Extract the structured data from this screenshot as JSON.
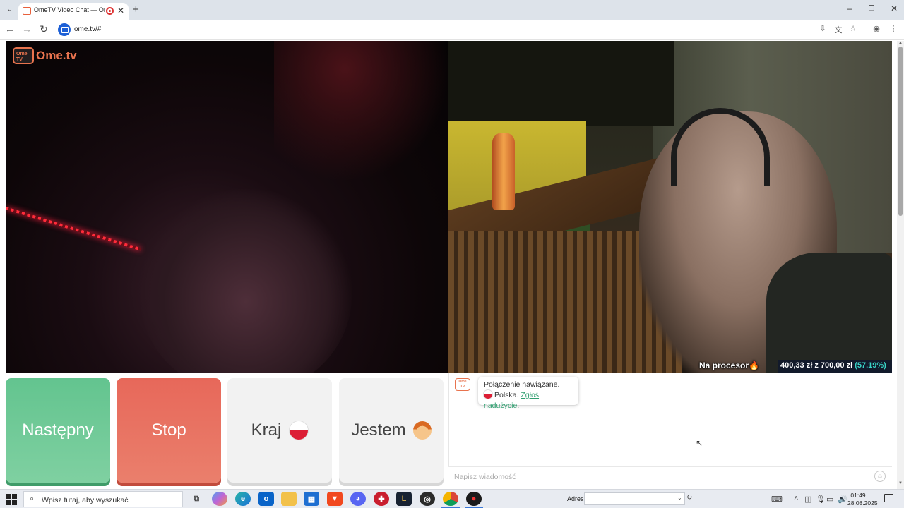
{
  "browser": {
    "tab_title": "OmeTV Video Chat — Ome",
    "url": "ome.tv/#",
    "new_tab_symbol": "+",
    "close_symbol": "✕"
  },
  "video": {
    "logo_box_text": "Ome TV",
    "logo_text": "Ome.tv",
    "overlay_caption": "Na procesor🔥",
    "donation_amount": "400,33 zł z 700,00 zł",
    "donation_percent": "(57.19%)",
    "donation_progress": 0.5719
  },
  "buttons": {
    "next": "Następny",
    "stop": "Stop",
    "country": "Kraj",
    "gender": "Jestem"
  },
  "chat": {
    "connected_message": "Połączenie nawiązane.",
    "country_name": "Polska.",
    "report_link": "Zgłoś nadużycie",
    "period": ".",
    "input_placeholder": "Napisz wiadomość"
  },
  "taskbar": {
    "search_placeholder": "Wpisz tutaj, aby wyszukać",
    "address_label": "Adres",
    "time": "01:49",
    "date": "28.08.2025",
    "apps": [
      "task-view",
      "copilot",
      "edge",
      "outlook",
      "file-explorer",
      "store",
      "brave",
      "discord",
      "opera",
      "league",
      "obs",
      "chrome",
      "app-red"
    ]
  },
  "colors": {
    "next_button": "#63c48f",
    "stop_button": "#e7685a",
    "brand_orange": "#e8734e",
    "report_link": "#2f9e6f",
    "donation_percent": "#39d3c7"
  }
}
